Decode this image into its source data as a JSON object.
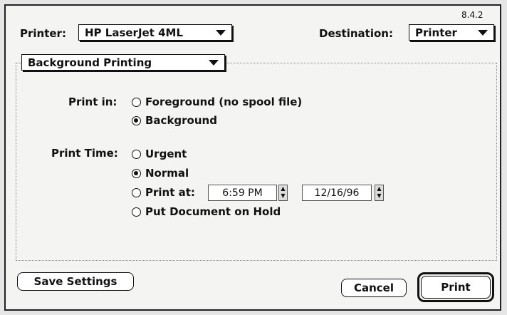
{
  "version": "8.4.2",
  "printer": {
    "label": "Printer:",
    "value": "HP LaserJet 4ML"
  },
  "destination": {
    "label": "Destination:",
    "value": "Printer"
  },
  "panel_select": {
    "value": "Background Printing"
  },
  "print_in": {
    "label": "Print in:",
    "options": [
      {
        "label": "Foreground (no spool file)",
        "selected": false
      },
      {
        "label": "Background",
        "selected": true
      }
    ]
  },
  "print_time": {
    "label": "Print Time:",
    "options": [
      {
        "label": "Urgent",
        "selected": false
      },
      {
        "label": "Normal",
        "selected": true
      },
      {
        "label": "Print at:",
        "selected": false
      },
      {
        "label": "Put Document on Hold",
        "selected": false
      }
    ],
    "time": "6:59 PM",
    "date": "12/16/96"
  },
  "buttons": {
    "save": "Save Settings",
    "cancel": "Cancel",
    "print": "Print"
  }
}
